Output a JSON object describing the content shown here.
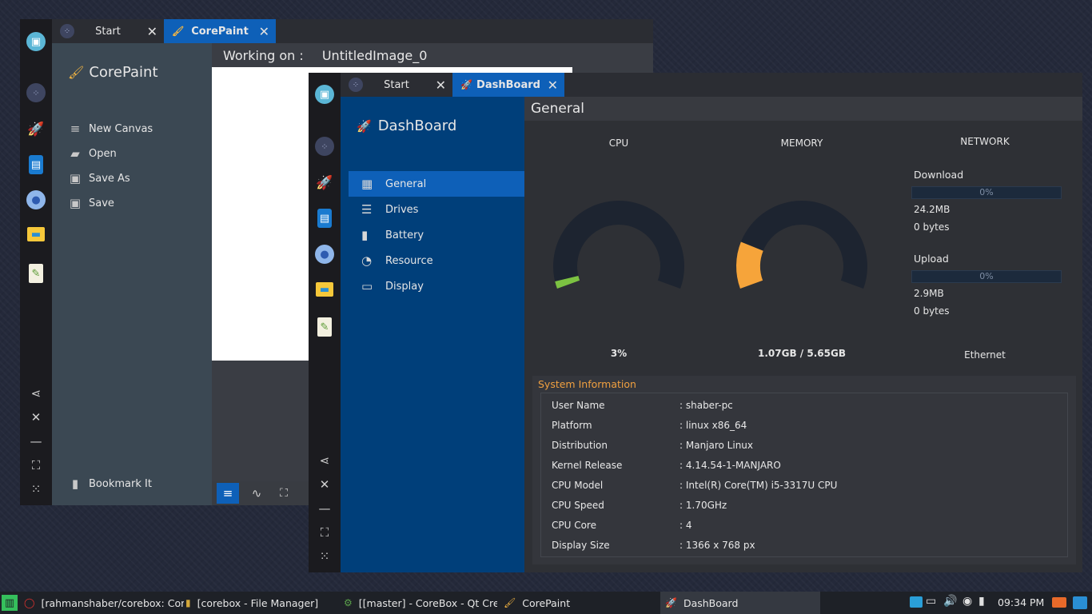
{
  "corepaint_window": {
    "tabs": [
      {
        "label": "Start",
        "close": "✕"
      },
      {
        "label": "CorePaint",
        "close": "✕"
      }
    ],
    "app_title": "CorePaint",
    "menu": [
      {
        "label": "New Canvas",
        "icon": "new-canvas-icon"
      },
      {
        "label": "Open",
        "icon": "folder-icon"
      },
      {
        "label": "Save As",
        "icon": "save-as-icon"
      },
      {
        "label": "Save",
        "icon": "save-icon"
      }
    ],
    "bookmark_label": "Bookmark It",
    "working_on_label": "Working on :",
    "working_on_value": "UntitledImage_0"
  },
  "dashboard_window": {
    "tabs": [
      {
        "label": "Start",
        "close": "✕"
      },
      {
        "label": "DashBoard",
        "close": "✕"
      }
    ],
    "app_title": "DashBoard",
    "nav": [
      {
        "label": "General",
        "icon": "grid-icon",
        "active": true
      },
      {
        "label": "Drives",
        "icon": "drives-icon"
      },
      {
        "label": "Battery",
        "icon": "battery-icon"
      },
      {
        "label": "Resource",
        "icon": "pie-icon"
      },
      {
        "label": "Display",
        "icon": "monitor-icon"
      }
    ],
    "section_title": "General",
    "cpu": {
      "label": "CPU",
      "value": "3%",
      "percent": 3,
      "color": "#7cc242"
    },
    "memory": {
      "label": "MEMORY",
      "value": "1.07GB / 5.65GB",
      "percent": 19,
      "color": "#f6a43a"
    },
    "network": {
      "label": "NETWORK",
      "download_label": "Download",
      "download_bar": "0%",
      "download_total": "24.2MB",
      "download_rate": "0 bytes",
      "upload_label": "Upload",
      "upload_bar": "0%",
      "upload_total": "2.9MB",
      "upload_rate": "0 bytes",
      "interface": "Ethernet"
    },
    "system_info_title": "System Information",
    "system_info": [
      {
        "key": "User Name",
        "value": ": shaber-pc"
      },
      {
        "key": "Platform",
        "value": ": linux x86_64"
      },
      {
        "key": "Distribution",
        "value": ": Manjaro Linux"
      },
      {
        "key": "Kernel Release",
        "value": ": 4.14.54-1-MANJARO"
      },
      {
        "key": "CPU Model",
        "value": ": Intel(R) Core(TM) i5-3317U CPU"
      },
      {
        "key": "CPU Speed",
        "value": ": 1.70GHz"
      },
      {
        "key": "CPU Core",
        "value": ": 4"
      },
      {
        "key": "Display Size",
        "value": ": 1366 x 768 px"
      }
    ]
  },
  "taskbar": {
    "items": [
      {
        "label": "[rahmanshaber/corebox: Com..."
      },
      {
        "label": "[corebox - File Manager]"
      },
      {
        "label": "[[master] - CoreBox - Qt Cre..."
      },
      {
        "label": "CorePaint"
      },
      {
        "label": "DashBoard"
      }
    ],
    "clock": "09:34 PM"
  },
  "colors": {
    "accent": "#0d5bb0",
    "sidebar_blue": "#003f7a",
    "paint_sidebar": "#3b4853"
  }
}
